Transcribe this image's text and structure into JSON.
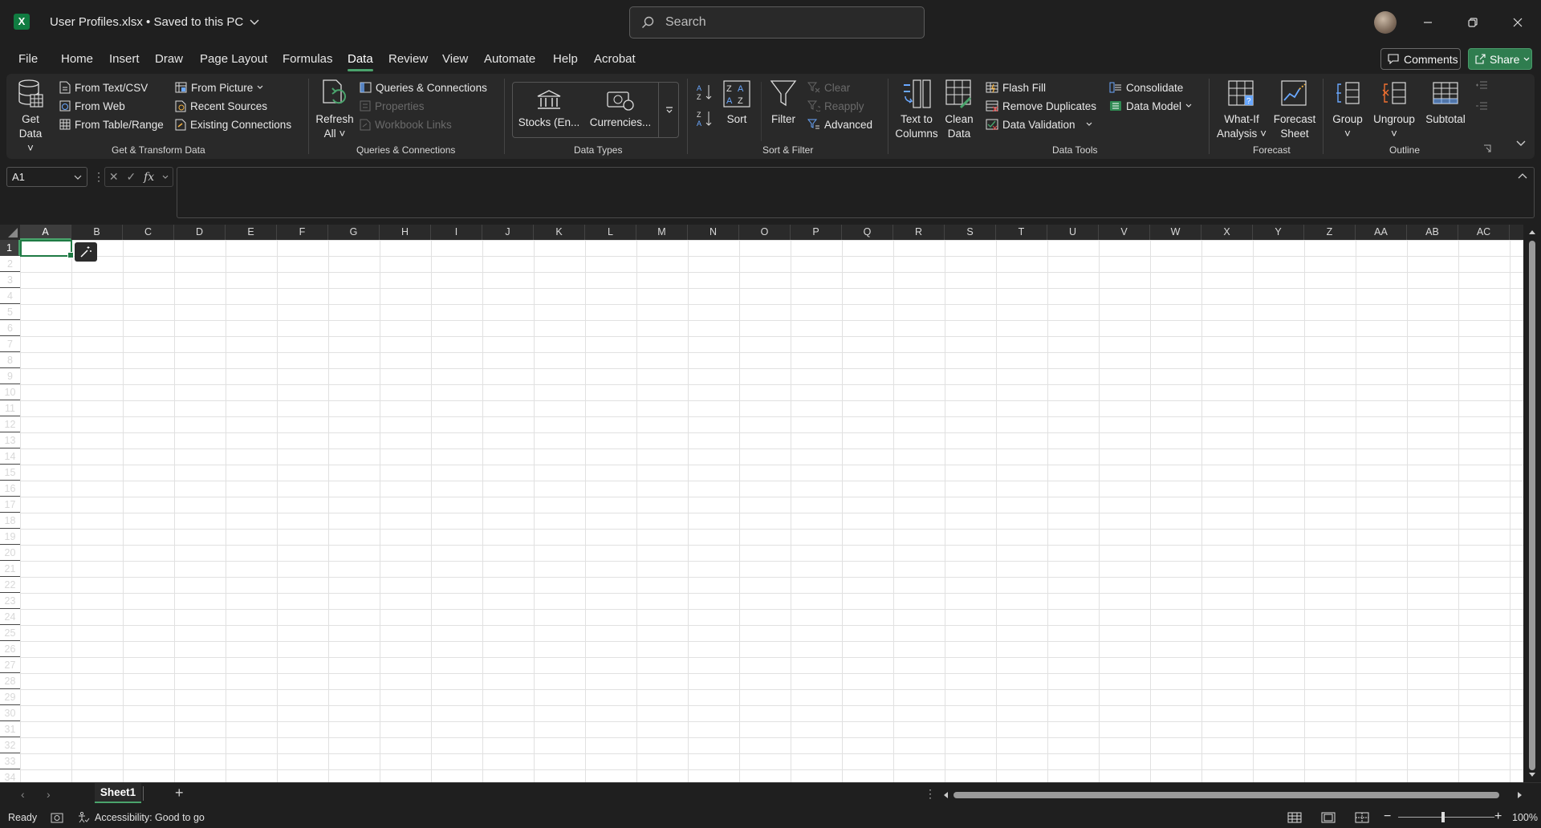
{
  "titlebar": {
    "app_icon": "X",
    "doc_title": "User Profiles.xlsx • Saved to this PC",
    "search_placeholder": "Search"
  },
  "menu_tabs": [
    "File",
    "Home",
    "Insert",
    "Draw",
    "Page Layout",
    "Formulas",
    "Data",
    "Review",
    "View",
    "Automate",
    "Help",
    "Acrobat"
  ],
  "active_tab": "Data",
  "buttons": {
    "comments": "Comments",
    "share": "Share"
  },
  "ribbon": {
    "get_transform": {
      "get_data_line1": "Get",
      "get_data_line2": "Data",
      "from_text_csv": "From Text/CSV",
      "from_web": "From Web",
      "from_table_range": "From Table/Range",
      "from_picture": "From Picture",
      "recent_sources": "Recent Sources",
      "existing_connections": "Existing Connections",
      "label": "Get & Transform Data"
    },
    "queries": {
      "refresh_line1": "Refresh",
      "refresh_line2": "All",
      "queries_connections": "Queries & Connections",
      "properties": "Properties",
      "workbook_links": "Workbook Links",
      "label": "Queries & Connections"
    },
    "data_types": {
      "stocks": "Stocks (En...",
      "currencies": "Currencies...",
      "label": "Data Types"
    },
    "sort_filter": {
      "sort": "Sort",
      "filter": "Filter",
      "clear": "Clear",
      "reapply": "Reapply",
      "advanced": "Advanced",
      "label": "Sort & Filter"
    },
    "data_tools": {
      "text_to_columns_line1": "Text to",
      "text_to_columns_line2": "Columns",
      "clean_data_line1": "Clean",
      "clean_data_line2": "Data",
      "flash_fill": "Flash Fill",
      "remove_duplicates": "Remove Duplicates",
      "data_validation": "Data Validation",
      "consolidate": "Consolidate",
      "data_model": "Data Model",
      "label": "Data Tools"
    },
    "forecast": {
      "what_if_line1": "What-If",
      "what_if_line2": "Analysis",
      "forecast_sheet_line1": "Forecast",
      "forecast_sheet_line2": "Sheet",
      "label": "Forecast"
    },
    "outline": {
      "group": "Group",
      "ungroup": "Ungroup",
      "subtotal": "Subtotal",
      "label": "Outline"
    }
  },
  "formula_bar": {
    "name_box": "A1",
    "fx": "fx",
    "value": ""
  },
  "grid": {
    "columns": [
      "A",
      "B",
      "C",
      "D",
      "E",
      "F",
      "G",
      "H",
      "I",
      "J",
      "K",
      "L",
      "M",
      "N",
      "O",
      "P",
      "Q",
      "R",
      "S",
      "T",
      "U",
      "V",
      "W",
      "X",
      "Y",
      "Z",
      "AA",
      "AB",
      "AC"
    ],
    "rows": [
      "1",
      "2",
      "3",
      "4",
      "5",
      "6",
      "7",
      "8",
      "9",
      "10",
      "11",
      "12",
      "13",
      "14",
      "15",
      "16",
      "17",
      "18",
      "19",
      "20",
      "21",
      "22",
      "23",
      "24",
      "25",
      "26",
      "27",
      "28",
      "29",
      "30",
      "31",
      "32",
      "33",
      "34"
    ],
    "selected_cell": "A1"
  },
  "sheet_tabs": [
    "Sheet1"
  ],
  "status": {
    "ready": "Ready",
    "accessibility": "Accessibility: Good to go",
    "zoom": "100%"
  },
  "colors": {
    "accent": "#4aa36c",
    "excel_green": "#107c41",
    "share_bg": "#2f7d4f"
  }
}
